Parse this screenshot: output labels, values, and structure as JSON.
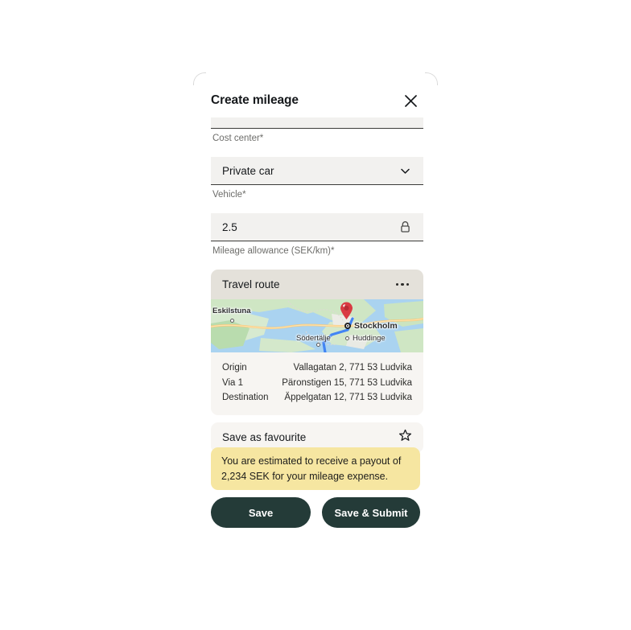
{
  "dialog": {
    "title": "Create mileage",
    "close_icon": "close-icon"
  },
  "form": {
    "fields": [
      {
        "value": "",
        "label": "Cost center*",
        "icon": "",
        "state": "clipped"
      },
      {
        "value": "Private car",
        "label": "Vehicle*",
        "icon": "chevron-down-icon",
        "state": "normal"
      },
      {
        "value": "2.5",
        "label": "Mileage allowance (SEK/km)*",
        "icon": "lock-icon",
        "state": "normal"
      }
    ]
  },
  "route": {
    "header_title": "Travel route",
    "menu_icon": "more-options-icon",
    "map": {
      "labels": [
        {
          "text": "Eskilstuna"
        },
        {
          "text": "Stockholm"
        },
        {
          "text": "Södertälje"
        },
        {
          "text": "Huddinge"
        }
      ],
      "pin_icon": "map-pin-icon"
    },
    "rows": [
      {
        "label": "Origin",
        "value": "Vallagatan 2, 771 53 Ludvika"
      },
      {
        "label": "Via 1",
        "value": "Päronstigen 15, 771 53 Ludvika"
      },
      {
        "label": "Destination",
        "value": "Äppelgatan 12, 771 53 Ludvika"
      }
    ]
  },
  "favourite": {
    "label": "Save as favourite",
    "icon": "star-outline-icon"
  },
  "toast": {
    "line1": "You are estimated to receive a payout of",
    "line2": "2,234 SEK for your mileage expense."
  },
  "footer": {
    "save_label": "Save",
    "submit_label": "Save & Submit"
  },
  "colors": {
    "button": "#243b38",
    "toast_bg": "#f6e6a1",
    "card_bg": "#f7f5f2",
    "field_bg": "#f2f1ef",
    "route_header_bg": "#e4e1da"
  }
}
